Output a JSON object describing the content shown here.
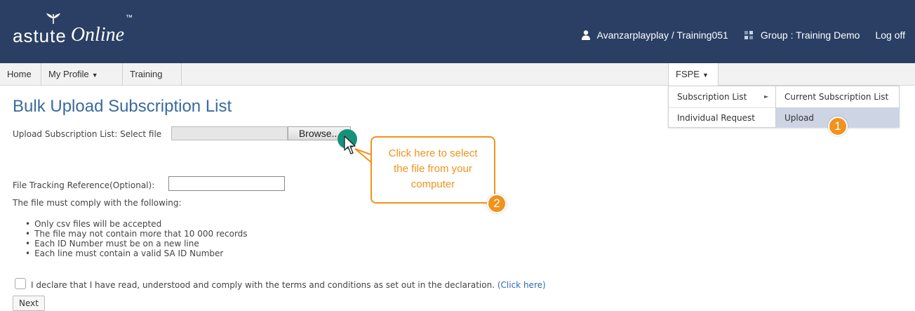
{
  "brand": {
    "name_main": "astute",
    "name_script": "Online",
    "tm": "™"
  },
  "header": {
    "user": "Avanzarplayplay / Training051",
    "group": "Group : Training Demo",
    "logoff": "Log off"
  },
  "nav": {
    "items": [
      {
        "label": "Home"
      },
      {
        "label": "My Profile",
        "caret": "▼"
      },
      {
        "label": "Training"
      }
    ],
    "fspe": {
      "label": "FSPE",
      "caret": "▼"
    }
  },
  "dropdown": {
    "left": [
      {
        "label": "Subscription List",
        "arrow": "►"
      },
      {
        "label": "Individual Request"
      }
    ],
    "right": [
      {
        "label": "Current Subscription List"
      },
      {
        "label": "Upload"
      }
    ]
  },
  "page": {
    "title": "Bulk Upload Subscription List",
    "upload_label": "Upload Subscription List: Select file",
    "browse_label": "Browse...",
    "ref_label": "File Tracking Reference(Optional):",
    "ref_value": "",
    "comply_text": "The file must comply with the following:",
    "rules": [
      "Only csv files will be accepted",
      "The file may not contain more that 10 000 records",
      "Each ID Number must be on a new line",
      "Each line must contain a valid SA ID Number"
    ],
    "declaration": "I declare that I have read, understood and comply with the terms and conditions as set out in the declaration.",
    "declaration_link": "(Click here)",
    "next_label": "Next"
  },
  "annotations": {
    "callout_lines": [
      "Click here to select",
      "the file from your",
      "computer"
    ],
    "badge1": "1",
    "badge2": "2",
    "accent": "#f0921b",
    "cursor_color": "#16917a"
  },
  "colors": {
    "header_bg": "#2a3f63",
    "title": "#3a6aa0",
    "link": "#2a6bb5",
    "menu_highlight": "#cdd4e3"
  }
}
